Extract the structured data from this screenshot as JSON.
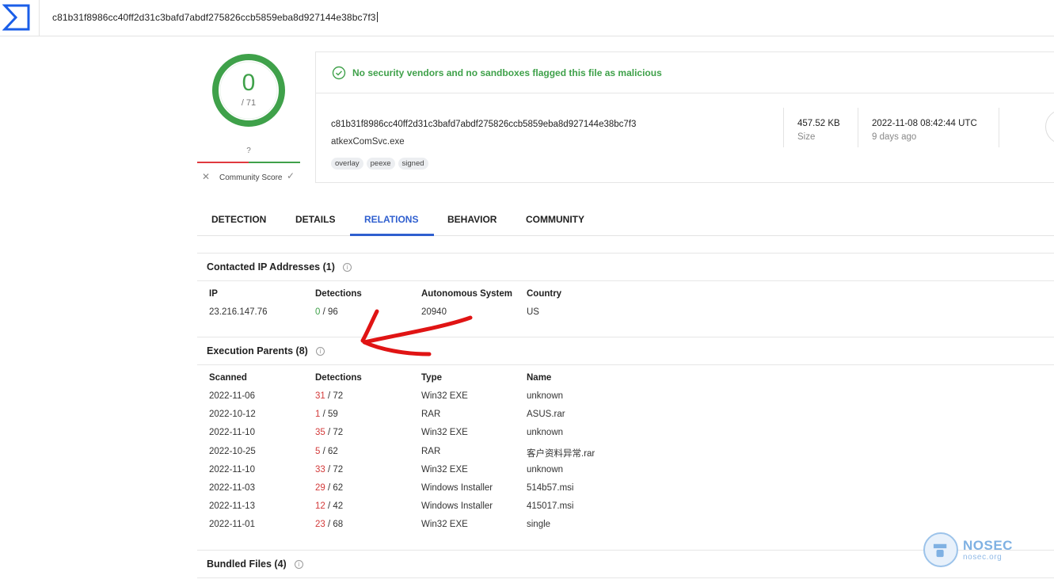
{
  "search": {
    "value": "c81b31f8986cc40ff2d31c3bafd7abdf275826ccb5859eba8d927144e38bc7f3"
  },
  "score": {
    "detections": "0",
    "total": "/ 71"
  },
  "community": {
    "score": "?",
    "label": "Community Score"
  },
  "verdict": {
    "text": "No security vendors and no sandboxes flagged this file as malicious"
  },
  "file": {
    "hash": "c81b31f8986cc40ff2d31c3bafd7abdf275826ccb5859eba8d927144e38bc7f3",
    "name": "atkexComSvc.exe",
    "tags": [
      "overlay",
      "peexe",
      "signed"
    ],
    "size_value": "457.52 KB",
    "size_label": "Size",
    "date_value": "2022-11-08 08:42:44 UTC",
    "date_label": "9 days ago"
  },
  "tabs": [
    "DETECTION",
    "DETAILS",
    "RELATIONS",
    "BEHAVIOR",
    "COMMUNITY"
  ],
  "active_tab": "RELATIONS",
  "contacted_ips": {
    "title": "Contacted IP Addresses (1)",
    "headers": [
      "IP",
      "Detections",
      "Autonomous System",
      "Country"
    ],
    "rows": [
      {
        "ip": "23.216.147.76",
        "det": "0",
        "det_total": "/ 96",
        "asn": "20940",
        "country": "US"
      }
    ]
  },
  "execution_parents": {
    "title": "Execution Parents (8)",
    "headers": [
      "Scanned",
      "Detections",
      "Type",
      "Name"
    ],
    "rows": [
      {
        "scanned": "2022-11-06",
        "det": "31",
        "det_total": "/ 72",
        "type": "Win32 EXE",
        "name": "unknown"
      },
      {
        "scanned": "2022-10-12",
        "det": "1",
        "det_total": "/ 59",
        "type": "RAR",
        "name": "ASUS.rar"
      },
      {
        "scanned": "2022-11-10",
        "det": "35",
        "det_total": "/ 72",
        "type": "Win32 EXE",
        "name": "unknown"
      },
      {
        "scanned": "2022-10-25",
        "det": "5",
        "det_total": "/ 62",
        "type": "RAR",
        "name": "客户资料异常.rar"
      },
      {
        "scanned": "2022-11-10",
        "det": "33",
        "det_total": "/ 72",
        "type": "Win32 EXE",
        "name": "unknown"
      },
      {
        "scanned": "2022-11-03",
        "det": "29",
        "det_total": "/ 62",
        "type": "Windows Installer",
        "name": "514b57.msi"
      },
      {
        "scanned": "2022-11-13",
        "det": "12",
        "det_total": "/ 42",
        "type": "Windows Installer",
        "name": "415017.msi"
      },
      {
        "scanned": "2022-11-01",
        "det": "23",
        "det_total": "/ 68",
        "type": "Win32 EXE",
        "name": "single"
      }
    ]
  },
  "bundled_files": {
    "title": "Bundled Files (4)"
  },
  "watermark": {
    "name": "NOSEC",
    "url": "nosec.org"
  },
  "colors": {
    "accent": "#2f5fcf",
    "clean": "#3fa14a",
    "malicious": "#d33a3a",
    "annotation": "#e01414"
  }
}
